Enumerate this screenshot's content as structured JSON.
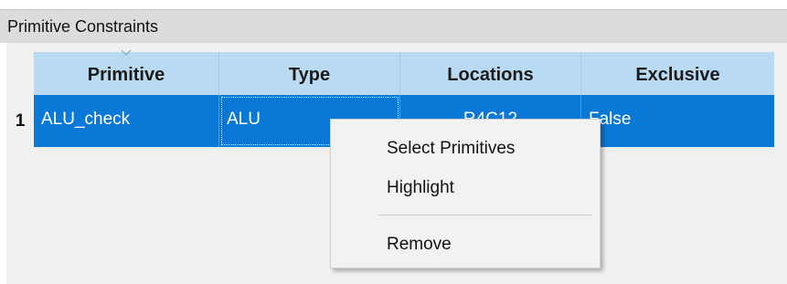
{
  "panel": {
    "title": "Primitive Constraints"
  },
  "table": {
    "columns": [
      "Primitive",
      "Type",
      "Locations",
      "Exclusive"
    ],
    "rows": [
      {
        "index": "1",
        "primitive": "ALU_check",
        "type": "ALU",
        "locations": "R4C12",
        "exclusive": "False"
      }
    ],
    "selection_color": "#0a78d7",
    "header_color": "#b8daf2"
  },
  "context_menu": {
    "items": [
      "Select Primitives",
      "Highlight",
      "Remove"
    ]
  }
}
